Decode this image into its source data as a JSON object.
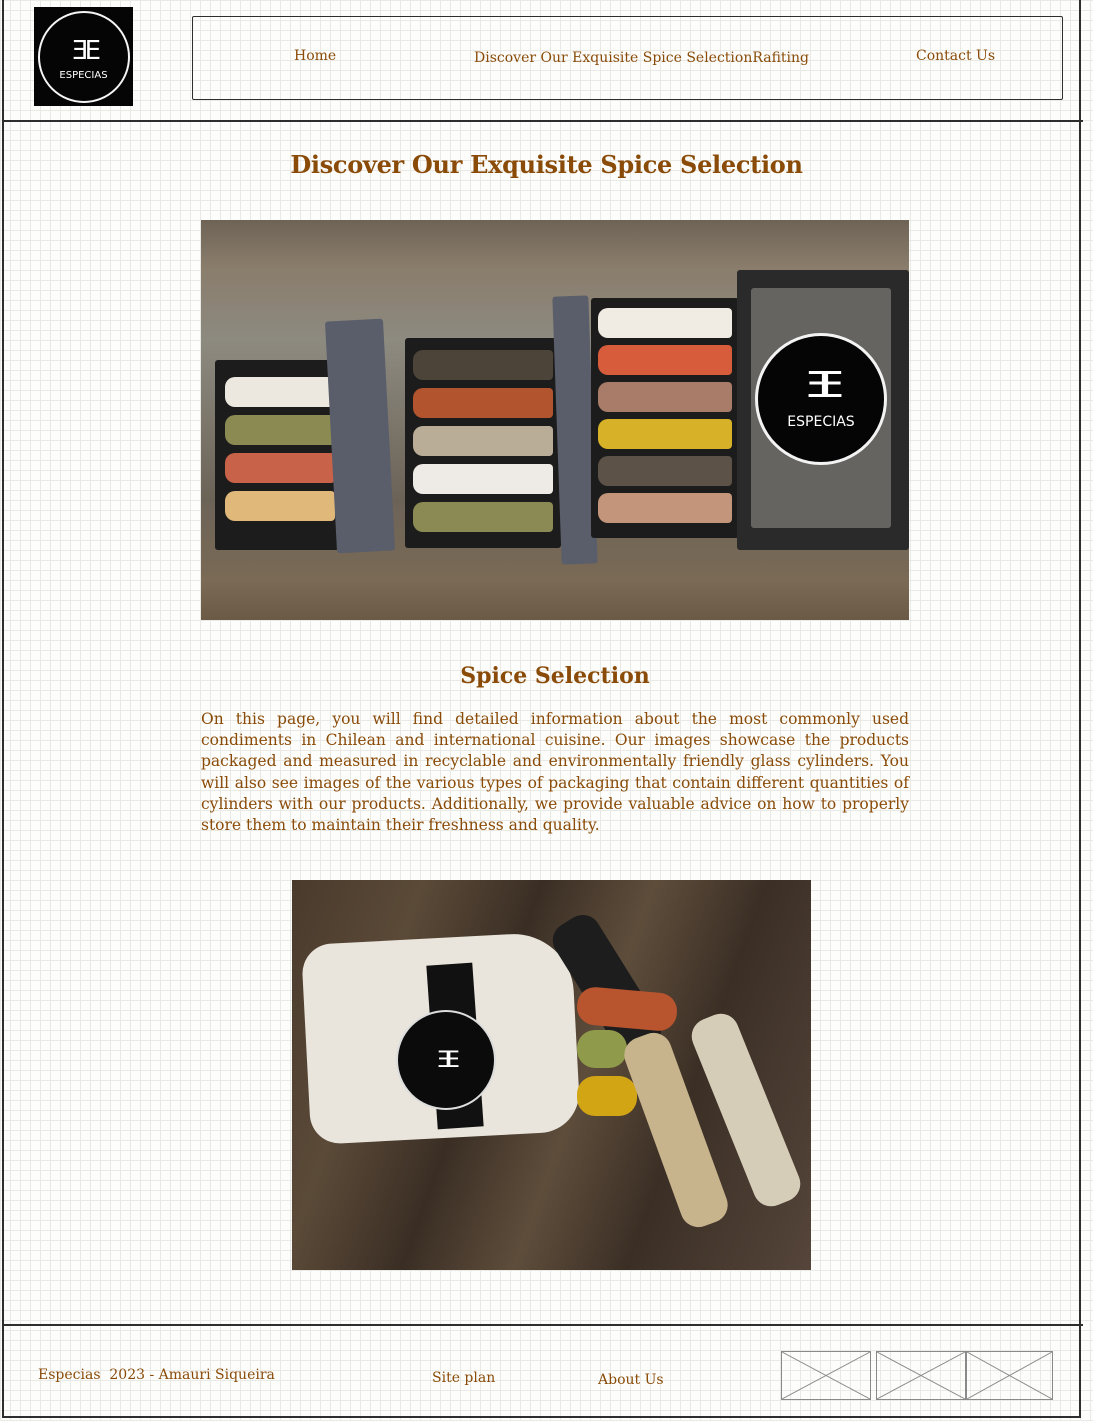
{
  "logo": {
    "glyph": "Ǝ E",
    "text": "ESPECIAS"
  },
  "nav": {
    "home": "Home",
    "discover": "Discover Our Exquisite Spice SelectionRafiting",
    "contact": "Contact Us"
  },
  "main": {
    "title": "Discover Our Exquisite Spice Selection",
    "hero_badge_glyph": "ƎE",
    "hero_badge_text": "ESPECIAS",
    "subtitle": "Spice Selection",
    "description": "On this page, you will find detailed information about the most commonly used condiments in Chilean and international cuisine. Our images showcase the products packaged and measured in recyclable and environmentally friendly glass cylinders. You will also see images of the various types of packaging that contain different quantities of cylinders with our products. Additionally, we provide valuable advice on how to properly store them to maintain their freshness and quality.",
    "bag_badge_glyph": "ƎE"
  },
  "footer": {
    "copyright": "Especias  2023 - Amauri Siqueira",
    "site_plan": "Site plan",
    "about_us": "About Us"
  },
  "colors": {
    "text": "#8a4b08",
    "frame": "#2e2e2e",
    "grid": "#e9e9e6"
  }
}
